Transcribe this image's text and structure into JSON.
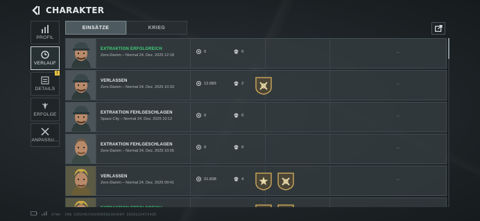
{
  "header": {
    "title": "CHARAKTER",
    "back_icon": "back-arrow-icon"
  },
  "sidebar": {
    "items": [
      {
        "label": "PROFIL",
        "icon": "bar-chart-icon",
        "active": false,
        "badge": ""
      },
      {
        "label": "VERLAUF",
        "icon": "history-icon",
        "active": true,
        "badge": ""
      },
      {
        "label": "DETAILS",
        "icon": "details-icon",
        "active": false,
        "badge": "!"
      },
      {
        "label": "ERFOLGE",
        "icon": "achievements-icon",
        "active": false,
        "badge": ""
      },
      {
        "label": "ANPASSU...",
        "icon": "customize-icon",
        "active": false,
        "badge": ""
      }
    ]
  },
  "tabs": [
    {
      "label": "EINSÄTZE",
      "active": true
    },
    {
      "label": "KRIEG",
      "active": false
    }
  ],
  "share_icon": "share-icon",
  "rows": [
    {
      "status": "EXTRAKTION ERFOLGREICH",
      "status_color": "#3fd27a",
      "sub": "Zero-Damm – Normal 24. Dez. 2025 12:18",
      "money": "0",
      "kills": "0",
      "medals": [],
      "result": "--",
      "avatar": "soldier-cap"
    },
    {
      "status": "VERLASSEN",
      "status_color": "#e8ecec",
      "sub": "Zero-Damm – Normal 24. Dez. 2025 10:33",
      "money": "12.083",
      "kills": "2",
      "medals": [
        "medal-crossed-icon"
      ],
      "result": "--",
      "avatar": "soldier-cap"
    },
    {
      "status": "EXTRAKTION FEHLGESCHLAGEN",
      "status_color": "#e8ecec",
      "sub": "Space City – Normal 24. Dez. 2025 10:12",
      "money": "0",
      "kills": "0",
      "medals": [],
      "result": "--",
      "avatar": "soldier-cap"
    },
    {
      "status": "EXTRAKTION FEHLGESCHLAGEN",
      "status_color": "#e8ecec",
      "sub": "Zero-Damm – Normal 24. Dez. 2025 10:05",
      "money": "0",
      "kills": "0",
      "medals": [],
      "result": "--",
      "avatar": "soldier-plain"
    },
    {
      "status": "VERLASSEN",
      "status_color": "#e8ecec",
      "sub": "Zero-Damm – Normal 24. Dez. 2025 09:41",
      "money": "21.838",
      "kills": "4",
      "medals": [
        "medal-star-icon",
        "medal-crossed-icon"
      ],
      "result": "--",
      "avatar": "soldier-gold"
    },
    {
      "status": "EXTRAKTION ERFOLGREICH",
      "status_color": "#3fd27a",
      "sub": "",
      "money": "",
      "kills": "",
      "medals": [
        "medal-star-icon",
        "medal-crossed-icon"
      ],
      "result": "",
      "avatar": "soldier-gold"
    }
  ],
  "footer": {
    "ping": "97ms",
    "uid": "IKB UID2457342565582394284 20251224T1435"
  },
  "colors": {
    "success": "#3fd27a",
    "badge": "#e8c442",
    "accent": "#4d5a5f"
  }
}
